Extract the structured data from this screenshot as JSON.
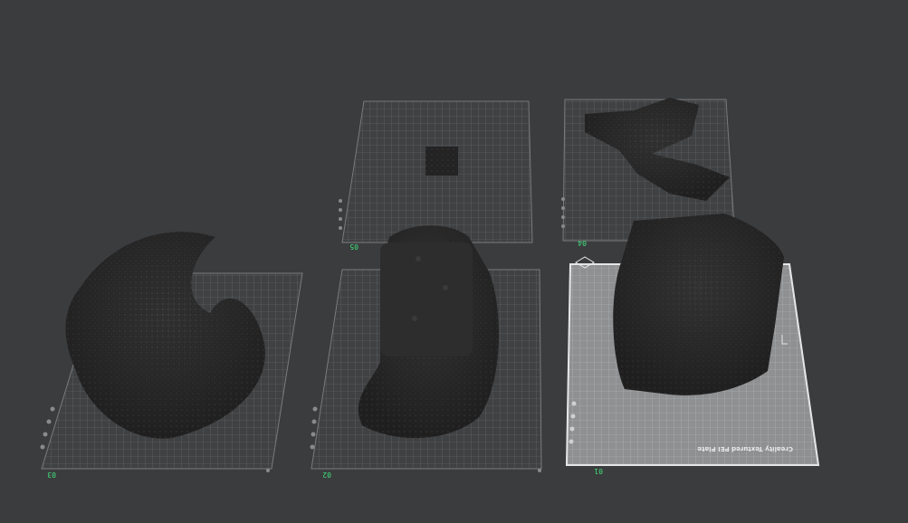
{
  "viewport": {
    "background": "#3b3c3e",
    "grid_color": "#6d6e70",
    "selected_plate_fill": "#8f9092",
    "model_color": "#2a2a2a"
  },
  "plates": [
    {
      "id": "plate-01",
      "label": "01",
      "selected": true,
      "name": "Creality Textured PEI Plate"
    },
    {
      "id": "plate-02",
      "label": "02",
      "selected": false
    },
    {
      "id": "plate-03",
      "label": "03",
      "selected": false
    },
    {
      "id": "plate-04",
      "label": "04",
      "selected": false
    },
    {
      "id": "plate-05",
      "label": "05",
      "selected": false
    }
  ]
}
